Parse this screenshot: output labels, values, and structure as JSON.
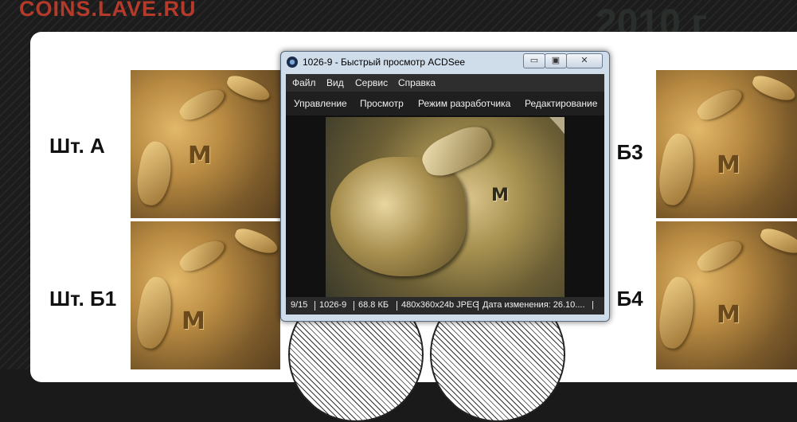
{
  "site": {
    "logo_text": "COINS.LAVE.RU",
    "ghost_heading": "2010 г"
  },
  "labels": {
    "a": "Шт. А",
    "b1": "Шт. Б1",
    "b3": ". Б3",
    "b4": ". Б4"
  },
  "coin_mark": "М",
  "window": {
    "title": "1026-9 - Быстрый просмотр ACDSee",
    "buttons": {
      "minimize": "▭",
      "maximize": "▣",
      "close": "✕"
    },
    "menu": [
      "Файл",
      "Вид",
      "Сервис",
      "Справка"
    ],
    "toolbar": [
      "Управление",
      "Просмотр",
      "Режим разработчика",
      "Редактирование"
    ],
    "photo_mark": "М",
    "status": {
      "position": "9/15",
      "filename": "1026-9",
      "size": "68.8 КБ",
      "format": "480x360x24b JPEG",
      "modified": "Дата изменения: 26.10....",
      "trailer": "|"
    }
  },
  "colors": {
    "logo": "#b53a2a",
    "menubar": "#2e2e2e",
    "toolbar": "#1f1f1f",
    "window_frame": "#cfdcea"
  }
}
